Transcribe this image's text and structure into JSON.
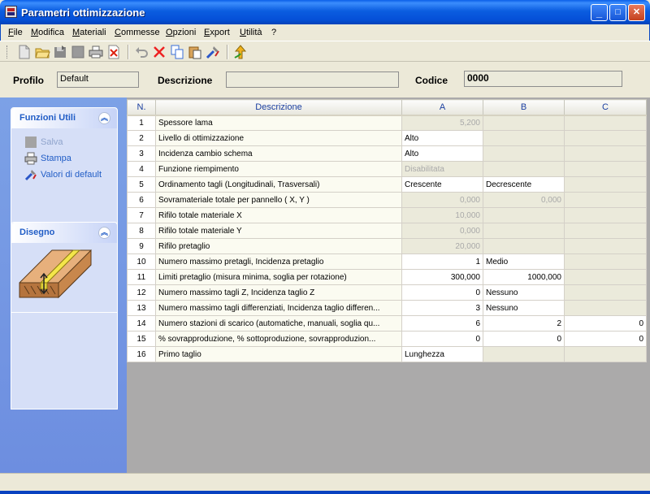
{
  "window": {
    "title": "Parametri ottimizzazione",
    "minimize": "_",
    "maximize": "□",
    "close": "✕"
  },
  "menu": [
    "File",
    "Modifica",
    "Materiali",
    "Commesse",
    "Opzioni",
    "Export",
    "Utilità",
    "?"
  ],
  "toolbar": {
    "icons": [
      "new-icon",
      "open-icon",
      "save-toolbar-icon",
      "blank-icon",
      "print-icon",
      "delete-file-icon",
      "undo-icon",
      "delete-icon",
      "copy-icon",
      "paste-icon",
      "tools-icon",
      "up-arrow-icon"
    ]
  },
  "header": {
    "profilo_label": "Profilo",
    "profilo_value": "Default",
    "descrizione_label": "Descrizione",
    "descrizione_value": "",
    "codice_label": "Codice",
    "codice_value": "0000"
  },
  "funzioni": {
    "title": "Funzioni Utili",
    "items": [
      {
        "label": "Salva"
      },
      {
        "label": "Stampa"
      },
      {
        "label": "Valori di default"
      }
    ]
  },
  "disegno": {
    "title": "Disegno"
  },
  "grid": {
    "headers": [
      "N.",
      "Descrizione",
      "A",
      "B",
      "C"
    ],
    "rows": [
      {
        "n": "1",
        "desc": "Spessore lama",
        "a": "5,200",
        "b": "",
        "c": ""
      },
      {
        "n": "2",
        "desc": "Livello di ottimizzazione",
        "a": "Alto",
        "b": "",
        "c": ""
      },
      {
        "n": "3",
        "desc": "Incidenza cambio schema",
        "a": "Alto",
        "b": "",
        "c": ""
      },
      {
        "n": "4",
        "desc": "Funzione riempimento",
        "a": "Disabilitata",
        "b": "",
        "c": ""
      },
      {
        "n": "5",
        "desc": "Ordinamento tagli (Longitudinali, Trasversali)",
        "a": "Crescente",
        "b": "Decrescente",
        "c": ""
      },
      {
        "n": "6",
        "desc": "Sovramateriale totale per pannello ( X, Y )",
        "a": "0,000",
        "b": "0,000",
        "c": ""
      },
      {
        "n": "7",
        "desc": "Rifilo totale materiale X",
        "a": "10,000",
        "b": "",
        "c": ""
      },
      {
        "n": "8",
        "desc": "Rifilo totale materiale Y",
        "a": "0,000",
        "b": "",
        "c": ""
      },
      {
        "n": "9",
        "desc": "Rifilo pretaglio",
        "a": "20,000",
        "b": "",
        "c": ""
      },
      {
        "n": "10",
        "desc": "Numero massimo pretagli, Incidenza pretaglio",
        "a": "1",
        "b": "Medio",
        "c": ""
      },
      {
        "n": "11",
        "desc": "Limiti pretaglio (misura minima, soglia per rotazione)",
        "a": "300,000",
        "b": "1000,000",
        "c": ""
      },
      {
        "n": "12",
        "desc": "Numero massimo tagli Z, Incidenza taglio Z",
        "a": "0",
        "b": "Nessuno",
        "c": ""
      },
      {
        "n": "13",
        "desc": "Numero massimo tagli differenziati, Incidenza taglio differen...",
        "a": "3",
        "b": "Nessuno",
        "c": ""
      },
      {
        "n": "14",
        "desc": "Numero stazioni di scarico (automatiche, manuali, soglia qu...",
        "a": "6",
        "b": "2",
        "c": "0"
      },
      {
        "n": "15",
        "desc": "% sovrapproduzione, % sottoproduzione, sovrapproduzion...",
        "a": "0",
        "b": "0",
        "c": "0"
      },
      {
        "n": "16",
        "desc": "Primo taglio",
        "a": "Lunghezza",
        "b": "",
        "c": ""
      }
    ]
  }
}
